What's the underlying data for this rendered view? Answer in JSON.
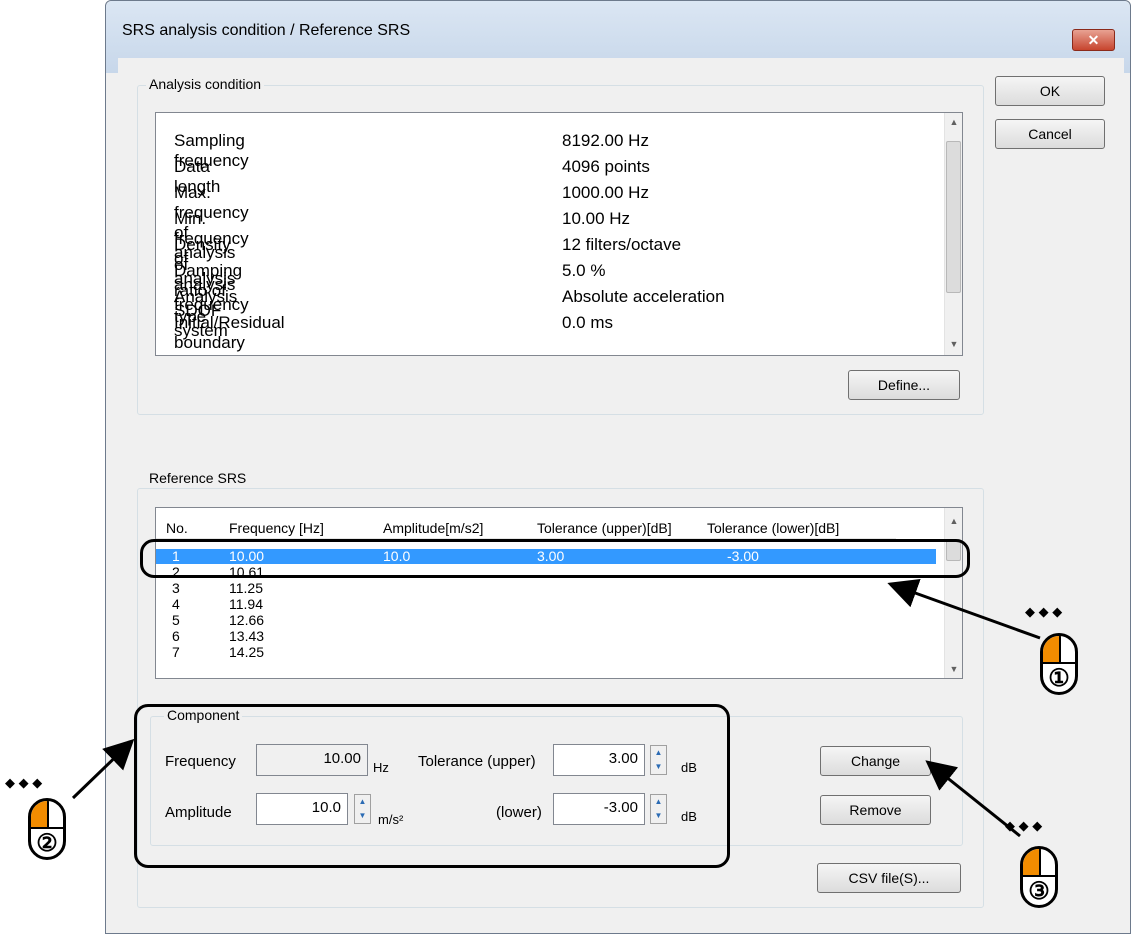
{
  "window": {
    "title": "SRS analysis condition / Reference SRS",
    "close_glyph": "✕"
  },
  "buttons": {
    "ok": "OK",
    "cancel": "Cancel",
    "define": "Define...",
    "change": "Change",
    "remove": "Remove",
    "csv": "CSV file(S)..."
  },
  "analysis": {
    "group_label": "Analysis condition",
    "rows": [
      {
        "name": "Sampling frequency",
        "value": "8192.00 Hz"
      },
      {
        "name": "Data length",
        "value": "4096 points"
      },
      {
        "name": "Max. frequency of analysis",
        "value": "1000.00 Hz"
      },
      {
        "name": "Min. frequency of analysis",
        "value": "10.00 Hz"
      },
      {
        "name": "Density of analysis frequency",
        "value": "12 filters/octave"
      },
      {
        "name": "Damping ratio of SDOF system",
        "value": "5.0 %"
      },
      {
        "name": "Analysis type",
        "value": "Absolute acceleration"
      },
      {
        "name": "Initial/Residual boundary",
        "value": "0.0 ms"
      }
    ]
  },
  "reference": {
    "group_label": "Reference SRS",
    "columns": [
      "No.",
      "Frequency [Hz]",
      "Amplitude[m/s2]",
      "Tolerance (upper)[dB]",
      "Tolerance (lower)[dB]"
    ],
    "rows": [
      {
        "no": "1",
        "freq": "10.00",
        "amp": "10.0",
        "tu": "3.00",
        "tl": "-3.00"
      },
      {
        "no": "2",
        "freq": "10.61",
        "amp": "",
        "tu": "",
        "tl": ""
      },
      {
        "no": "3",
        "freq": "11.25",
        "amp": "",
        "tu": "",
        "tl": ""
      },
      {
        "no": "4",
        "freq": "11.94",
        "amp": "",
        "tu": "",
        "tl": ""
      },
      {
        "no": "5",
        "freq": "12.66",
        "amp": "",
        "tu": "",
        "tl": ""
      },
      {
        "no": "6",
        "freq": "13.43",
        "amp": "",
        "tu": "",
        "tl": ""
      },
      {
        "no": "7",
        "freq": "14.25",
        "amp": "",
        "tu": "",
        "tl": ""
      }
    ]
  },
  "component": {
    "group_label": "Component",
    "frequency_label": "Frequency",
    "frequency_value": "10.00",
    "frequency_unit": "Hz",
    "amplitude_label": "Amplitude",
    "amplitude_value": "10.0",
    "amplitude_unit": "m/s²",
    "tol_upper_label": "Tolerance (upper)",
    "tol_upper_value": "3.00",
    "tol_lower_label": "(lower)",
    "tol_lower_value": "-3.00",
    "db_unit": "dB"
  },
  "annotations": {
    "step1": "①",
    "step2": "②",
    "step3": "③"
  },
  "colors": {
    "accent_orange": "#f28c00",
    "selection_blue": "#3399ff"
  }
}
